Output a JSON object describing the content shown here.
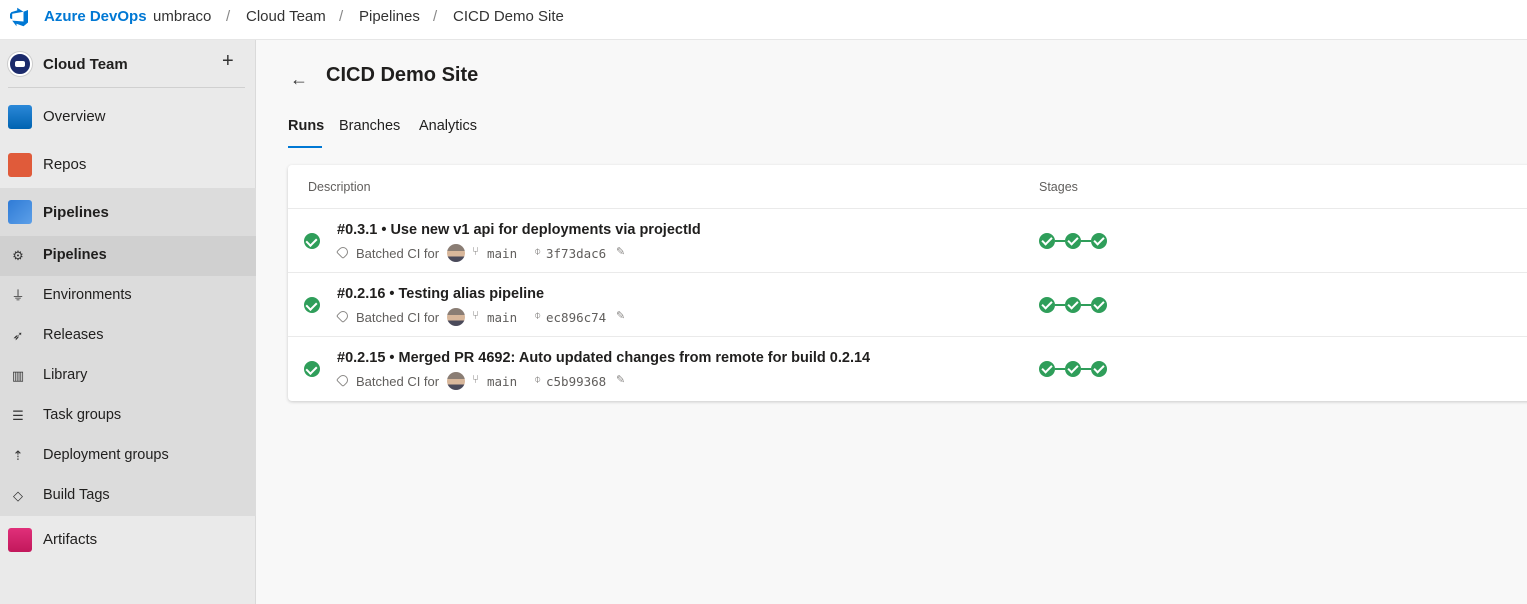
{
  "topbar": {
    "brand": "Azure DevOps",
    "breadcrumbs": [
      "umbraco",
      "Cloud Team",
      "Pipelines",
      "CICD Demo Site"
    ],
    "separator": "/"
  },
  "sidebar": {
    "project": "Cloud Team",
    "add_icon": "plus-icon",
    "items": [
      {
        "label": "Overview",
        "icon": "overview-icon"
      },
      {
        "label": "Repos",
        "icon": "repos-icon"
      },
      {
        "label": "Pipelines",
        "icon": "pipelines-icon"
      },
      {
        "label": "Pipelines",
        "icon": "pipeline-sub-icon"
      },
      {
        "label": "Environments",
        "icon": "environments-icon"
      },
      {
        "label": "Releases",
        "icon": "releases-icon"
      },
      {
        "label": "Library",
        "icon": "library-icon"
      },
      {
        "label": "Task groups",
        "icon": "task-groups-icon"
      },
      {
        "label": "Deployment groups",
        "icon": "deployment-groups-icon"
      },
      {
        "label": "Build Tags",
        "icon": "tag-icon"
      },
      {
        "label": "Artifacts",
        "icon": "artifacts-icon"
      }
    ]
  },
  "main": {
    "title": "CICD Demo Site",
    "tabs": [
      {
        "label": "Runs",
        "active": true
      },
      {
        "label": "Branches",
        "active": false
      },
      {
        "label": "Analytics",
        "active": false
      }
    ],
    "table": {
      "columns": [
        "Description",
        "Stages"
      ],
      "rows": [
        {
          "title": "#0.3.1 • Use new v1 api for deployments via projectId",
          "trigger": "Batched CI for",
          "branch": "main",
          "commit": "3f73dac6",
          "status": "succeeded",
          "stages": 3
        },
        {
          "title": "#0.2.16 • Testing alias pipeline",
          "trigger": "Batched CI for",
          "branch": "main",
          "commit": "ec896c74",
          "status": "succeeded",
          "stages": 3
        },
        {
          "title": "#0.2.15 • Merged PR 4692: Auto updated changes from remote for build 0.2.14",
          "trigger": "Batched CI for",
          "branch": "main",
          "commit": "c5b99368",
          "status": "succeeded",
          "stages": 3
        }
      ]
    }
  },
  "colors": {
    "accent": "#0078d4",
    "success": "#2f9e5a"
  }
}
